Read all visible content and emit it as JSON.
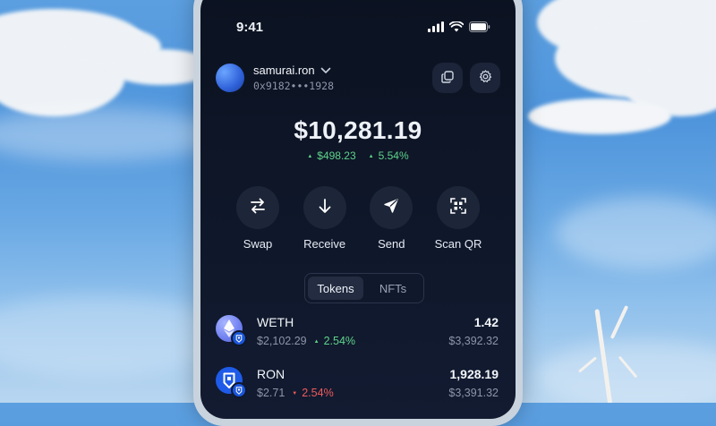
{
  "status_bar": {
    "time": "9:41",
    "icons": [
      "signal-icon",
      "wifi-icon",
      "battery-icon"
    ]
  },
  "account": {
    "name": "samurai.ron",
    "address": "0x9182•••1928",
    "icons": [
      "chevron-down-icon",
      "copy-icon",
      "settings-gear-icon"
    ]
  },
  "balance": {
    "total": "$10,281.19",
    "change_amount": "$498.23",
    "change_percent": "5.54%"
  },
  "actions": [
    {
      "label": "Swap",
      "icon": "swap-arrows-icon"
    },
    {
      "label": "Receive",
      "icon": "arrow-down-icon"
    },
    {
      "label": "Send",
      "icon": "send-icon"
    },
    {
      "label": "Scan QR",
      "icon": "scan-qr-icon"
    }
  ],
  "tabs": {
    "items": [
      "Tokens",
      "NFTs"
    ],
    "active": "Tokens"
  },
  "tokens": [
    {
      "symbol": "WETH",
      "price": "$2,102.29",
      "change": "2.54%",
      "direction": "up",
      "amount": "1.42",
      "value": "$3,392.32"
    },
    {
      "symbol": "RON",
      "price": "$2.71",
      "change": "2.54%",
      "direction": "down",
      "amount": "1,928.19",
      "value": "$3,391.32"
    }
  ],
  "colors": {
    "positive": "#5fd38a",
    "negative": "#ef5b5b",
    "accent": "#1a56db",
    "screen_bg": "#0e1628"
  }
}
